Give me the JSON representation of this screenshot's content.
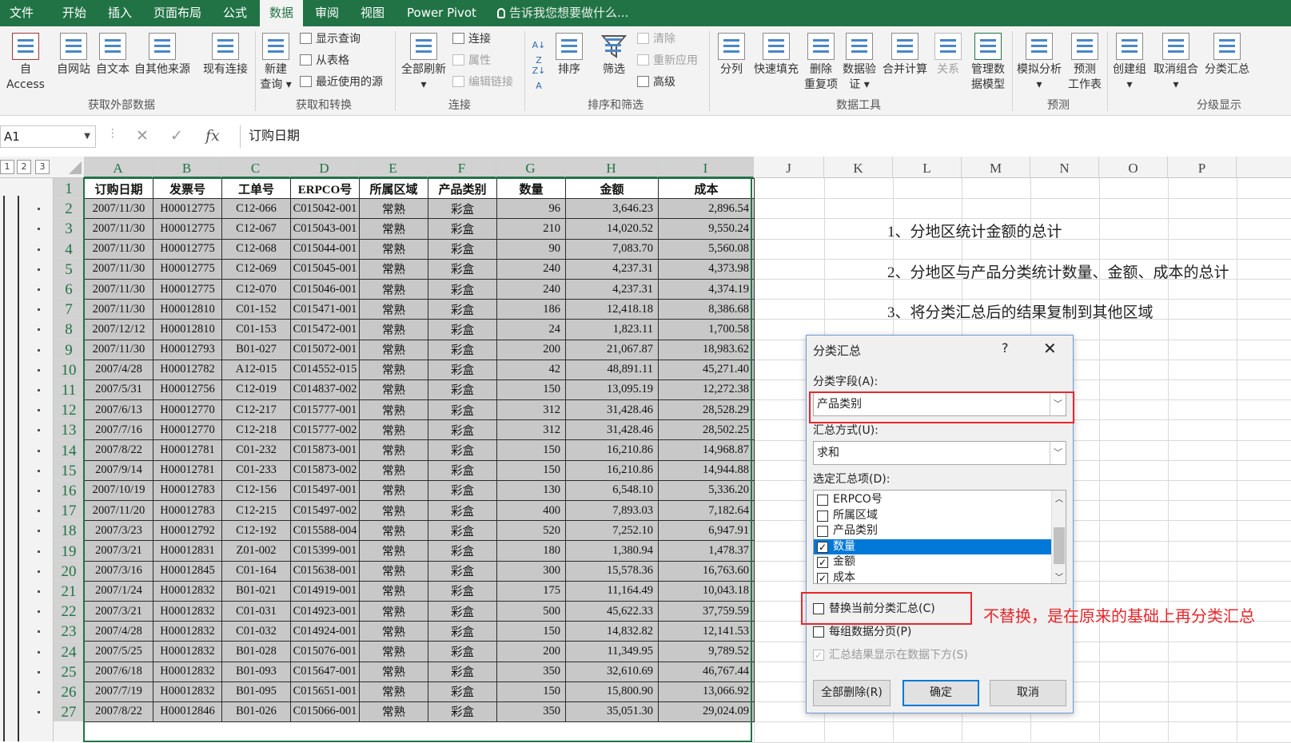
{
  "tabs": [
    "文件",
    "开始",
    "插入",
    "页面布局",
    "公式",
    "数据",
    "审阅",
    "视图",
    "Power Pivot"
  ],
  "active_tab": "数据",
  "tell_me": "告诉我您想要做什么...",
  "ribbon": {
    "access": "自 Access",
    "web": "自网站",
    "text": "自文本",
    "other": "自其他来源",
    "existing": "现有连接",
    "new_query_1": "新建",
    "new_query_2": "查询 ▾",
    "show_query": "显示查询",
    "from_table": "从表格",
    "recent_source": "最近使用的源",
    "refresh_all": "全部刷新",
    "refresh_dd": "▾",
    "connections": "连接",
    "properties": "属性",
    "edit_links": "编辑链接",
    "sort": "排序",
    "filter": "筛选",
    "clear": "清除",
    "reapply": "重新应用",
    "advanced": "高级",
    "text_to_col": "分列",
    "flash_fill": "快速填充",
    "remove_dup_1": "删除",
    "remove_dup_2": "重复项",
    "validation_1": "数据验",
    "validation_2": "证 ▾",
    "consolidate": "合并计算",
    "relationships": "关系",
    "manage_model_1": "管理数",
    "manage_model_2": "据模型",
    "whatif_1": "模拟分析",
    "whatif_2": "▾",
    "forecast_1": "预测",
    "forecast_2": "工作表",
    "group": "创建组",
    "group_dd": "▾",
    "ungroup": "取消组合",
    "ungroup_dd": "▾",
    "subtotal": "分类汇总",
    "groups": [
      "获取外部数据",
      "获取和转换",
      "连接",
      "排序和筛选",
      "数据工具",
      "预测",
      "分级显示"
    ]
  },
  "formula_bar": {
    "name_box": "A1",
    "formula": "订购日期"
  },
  "columns": [
    "A",
    "B",
    "C",
    "D",
    "E",
    "F",
    "G",
    "H",
    "I",
    "J",
    "K",
    "L",
    "M",
    "N",
    "O",
    "P"
  ],
  "outline_levels": [
    "1",
    "2",
    "3"
  ],
  "row_numbers": [
    "1",
    "2",
    "3",
    "4",
    "5",
    "6",
    "7",
    "8",
    "9",
    "10",
    "11",
    "12",
    "13",
    "14",
    "15",
    "16",
    "17",
    "18",
    "19",
    "20",
    "21",
    "22",
    "23",
    "24",
    "25",
    "26",
    "27"
  ],
  "table": {
    "headers": [
      "订购日期",
      "发票号",
      "工单号",
      "ERPCO号",
      "所属区域",
      "产品类别",
      "数量",
      "金额",
      "成本"
    ],
    "rows": [
      [
        "2007/11/30",
        "H00012775",
        "C12-066",
        "C015042-001",
        "常熟",
        "彩盒",
        "96",
        "3,646.23",
        "2,896.54"
      ],
      [
        "2007/11/30",
        "H00012775",
        "C12-067",
        "C015043-001",
        "常熟",
        "彩盒",
        "210",
        "14,020.52",
        "9,550.24"
      ],
      [
        "2007/11/30",
        "H00012775",
        "C12-068",
        "C015044-001",
        "常熟",
        "彩盒",
        "90",
        "7,083.70",
        "5,560.08"
      ],
      [
        "2007/11/30",
        "H00012775",
        "C12-069",
        "C015045-001",
        "常熟",
        "彩盒",
        "240",
        "4,237.31",
        "4,373.98"
      ],
      [
        "2007/11/30",
        "H00012775",
        "C12-070",
        "C015046-001",
        "常熟",
        "彩盒",
        "240",
        "4,237.31",
        "4,374.19"
      ],
      [
        "2007/11/30",
        "H00012810",
        "C01-152",
        "C015471-001",
        "常熟",
        "彩盒",
        "186",
        "12,418.18",
        "8,386.68"
      ],
      [
        "2007/12/12",
        "H00012810",
        "C01-153",
        "C015472-001",
        "常熟",
        "彩盒",
        "24",
        "1,823.11",
        "1,700.58"
      ],
      [
        "2007/11/30",
        "H00012793",
        "B01-027",
        "C015072-001",
        "常熟",
        "彩盒",
        "200",
        "21,067.87",
        "18,983.62"
      ],
      [
        "2007/4/28",
        "H00012782",
        "A12-015",
        "C014552-015",
        "常熟",
        "彩盒",
        "42",
        "48,891.11",
        "45,271.40"
      ],
      [
        "2007/5/31",
        "H00012756",
        "C12-019",
        "C014837-002",
        "常熟",
        "彩盒",
        "150",
        "13,095.19",
        "12,272.38"
      ],
      [
        "2007/6/13",
        "H00012770",
        "C12-217",
        "C015777-001",
        "常熟",
        "彩盒",
        "312",
        "31,428.46",
        "28,528.29"
      ],
      [
        "2007/7/16",
        "H00012770",
        "C12-218",
        "C015777-002",
        "常熟",
        "彩盒",
        "312",
        "31,428.46",
        "28,502.25"
      ],
      [
        "2007/8/22",
        "H00012781",
        "C01-232",
        "C015873-001",
        "常熟",
        "彩盒",
        "150",
        "16,210.86",
        "14,968.87"
      ],
      [
        "2007/9/14",
        "H00012781",
        "C01-233",
        "C015873-002",
        "常熟",
        "彩盒",
        "150",
        "16,210.86",
        "14,944.88"
      ],
      [
        "2007/10/19",
        "H00012783",
        "C12-156",
        "C015497-001",
        "常熟",
        "彩盒",
        "130",
        "6,548.10",
        "5,336.20"
      ],
      [
        "2007/11/20",
        "H00012783",
        "C12-215",
        "C015497-002",
        "常熟",
        "彩盒",
        "400",
        "7,893.03",
        "7,182.64"
      ],
      [
        "2007/3/23",
        "H00012792",
        "C12-192",
        "C015588-004",
        "常熟",
        "彩盒",
        "520",
        "7,252.10",
        "6,947.91"
      ],
      [
        "2007/3/21",
        "H00012831",
        "Z01-002",
        "C015399-001",
        "常熟",
        "彩盒",
        "180",
        "1,380.94",
        "1,478.37"
      ],
      [
        "2007/3/16",
        "H00012845",
        "C01-164",
        "C015638-001",
        "常熟",
        "彩盒",
        "300",
        "15,578.36",
        "16,763.60"
      ],
      [
        "2007/1/24",
        "H00012832",
        "B01-021",
        "C014919-001",
        "常熟",
        "彩盒",
        "175",
        "11,164.49",
        "10,043.18"
      ],
      [
        "2007/3/21",
        "H00012832",
        "C01-031",
        "C014923-001",
        "常熟",
        "彩盒",
        "500",
        "45,622.33",
        "37,759.59"
      ],
      [
        "2007/4/28",
        "H00012832",
        "C01-032",
        "C014924-001",
        "常熟",
        "彩盒",
        "150",
        "14,832.82",
        "12,141.53"
      ],
      [
        "2007/5/25",
        "H00012832",
        "B01-028",
        "C015076-001",
        "常熟",
        "彩盒",
        "200",
        "11,349.95",
        "9,789.52"
      ],
      [
        "2007/6/18",
        "H00012832",
        "B01-093",
        "C015647-001",
        "常熟",
        "彩盒",
        "350",
        "32,610.69",
        "46,767.44"
      ],
      [
        "2007/7/19",
        "H00012832",
        "B01-095",
        "C015651-001",
        "常熟",
        "彩盒",
        "150",
        "15,800.90",
        "13,066.92"
      ],
      [
        "2007/8/22",
        "H00012846",
        "B01-026",
        "C015066-001",
        "常熟",
        "彩盒",
        "350",
        "35,051.30",
        "29,024.09"
      ]
    ]
  },
  "notes": [
    "1、分地区统计金额的总计",
    "2、分地区与产品分类统计数量、金额、成本的总计",
    "3、将分类汇总后的结果复制到其他区域"
  ],
  "dialog": {
    "title": "分类汇总",
    "help": "?",
    "close": "✕",
    "field_label": "分类字段(A):",
    "field_value": "产品类别",
    "method_label": "汇总方式(U):",
    "method_value": "求和",
    "items_label": "选定汇总项(D):",
    "items": [
      {
        "label": "ERPCO号",
        "checked": false,
        "selected": false
      },
      {
        "label": "所属区域",
        "checked": false,
        "selected": false
      },
      {
        "label": "产品类别",
        "checked": false,
        "selected": false
      },
      {
        "label": "数量",
        "checked": true,
        "selected": true
      },
      {
        "label": "金额",
        "checked": true,
        "selected": false
      },
      {
        "label": "成本",
        "checked": true,
        "selected": false
      }
    ],
    "replace_label": "替换当前分类汇总(C)",
    "pagebreak_label": "每组数据分页(P)",
    "below_label": "汇总结果显示在数据下方(S)",
    "remove_all": "全部删除(R)",
    "ok": "确定",
    "cancel": "取消"
  },
  "annotation": "不替换，是在原来的基础上再分类汇总",
  "colors": {
    "accent": "#217346",
    "annotation": "#e8262b",
    "selection": "#0078d7"
  }
}
